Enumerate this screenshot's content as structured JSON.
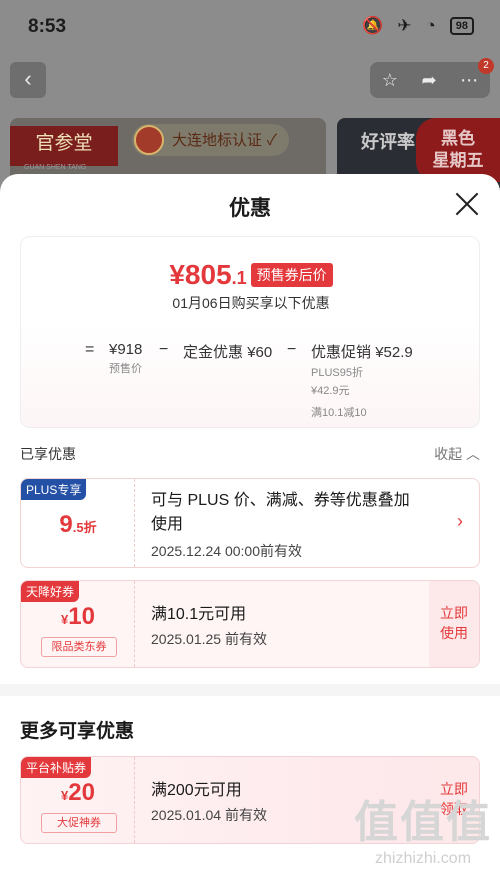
{
  "status_bar": {
    "time": "8:53",
    "battery": "98"
  },
  "product_page": {
    "notification_count": "2",
    "brand_name": "官参堂",
    "brand_sub": "GUAN SHEN TANG",
    "cert_badge": "大连地标认证",
    "right_banner_text": "好评率",
    "black_friday_line1": "黑色",
    "black_friday_line2": "星期五"
  },
  "sheet": {
    "title": "优惠",
    "price": {
      "currency": "¥",
      "integer": "805",
      "decimal": ".1",
      "tag": "预售券后价",
      "date_note": "01月06日购买享以下优惠"
    },
    "calc": {
      "eq": "=",
      "presale_value": "¥918",
      "presale_label": "预售价",
      "minus1": "−",
      "deposit_label": "定金优惠",
      "deposit_value": "¥60",
      "minus2": "−",
      "promo_label": "优惠促销",
      "promo_value": "¥52.9",
      "promo_detail1": "PLUS95折",
      "promo_detail2": "¥42.9元",
      "promo_detail3": "满10.1减10"
    },
    "enjoyed_label": "已享优惠",
    "collapse_label": "收起",
    "coupons_enjoyed": [
      {
        "tag": "PLUS专享",
        "value_big": "9",
        "value_small": ".5折",
        "text_line1": "可与 PLUS 价、满减、券等优惠叠加",
        "text_line2": "使用",
        "date": "2025.12.24 00:00前有效"
      },
      {
        "tag": "天降好券",
        "currency": "¥",
        "value_big": "10",
        "chip": "限品类东券",
        "text_line1": "满10.1元可用",
        "date": "2025.01.25 前有效",
        "action_line1": "立即",
        "action_line2": "使用"
      }
    ],
    "more_title": "更多可享优惠",
    "coupons_more": [
      {
        "tag": "平台补贴券",
        "currency": "¥",
        "value_big": "20",
        "chip": "大促神券",
        "text_line1": "满200元可用",
        "date": "2025.01.04 前有效",
        "action_line1": "立即",
        "action_line2": "领取"
      }
    ]
  },
  "watermark": {
    "big": "值值值",
    "url": "zhizhizhi.com"
  },
  "colors": {
    "accent": "#e4393c",
    "plus_blue": "#2450a6",
    "dim_bg": "#8c8c8c"
  }
}
